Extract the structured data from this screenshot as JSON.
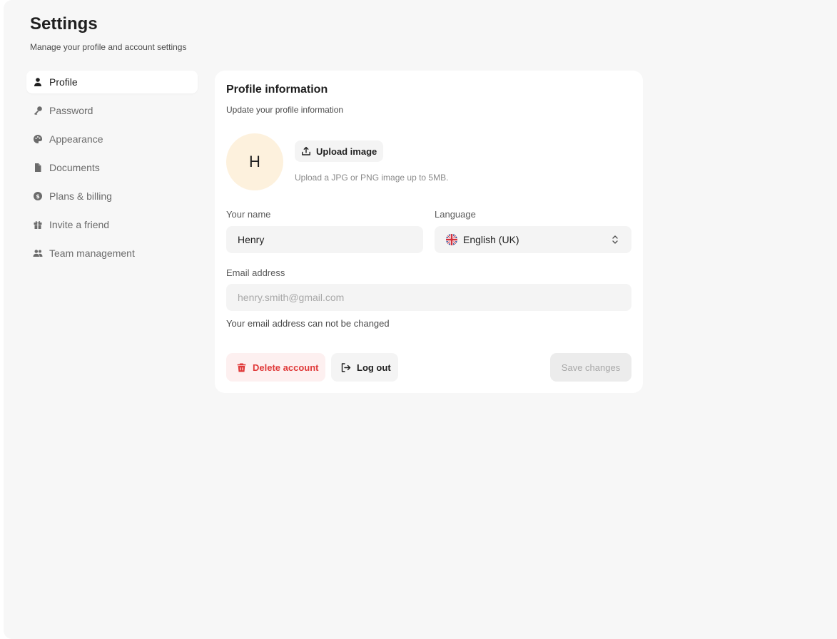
{
  "header": {
    "title": "Settings",
    "subtitle": "Manage your profile and account settings"
  },
  "sidebar": {
    "items": [
      {
        "label": "Profile",
        "icon": "user-icon",
        "active": true
      },
      {
        "label": "Password",
        "icon": "key-icon",
        "active": false
      },
      {
        "label": "Appearance",
        "icon": "palette-icon",
        "active": false
      },
      {
        "label": "Documents",
        "icon": "document-icon",
        "active": false
      },
      {
        "label": "Plans & billing",
        "icon": "dollar-icon",
        "active": false
      },
      {
        "label": "Invite a friend",
        "icon": "gift-icon",
        "active": false
      },
      {
        "label": "Team management",
        "icon": "team-icon",
        "active": false
      }
    ]
  },
  "profile": {
    "title": "Profile information",
    "subtitle": "Update your profile information",
    "avatar_initial": "H",
    "upload_label": "Upload image",
    "upload_hint": "Upload a JPG or PNG image up to 5MB.",
    "name_label": "Your name",
    "name_value": "Henry",
    "language_label": "Language",
    "language_value": "English (UK)",
    "email_label": "Email address",
    "email_placeholder": "henry.smith@gmail.com",
    "email_hint": "Your email address can not be changed"
  },
  "actions": {
    "delete_label": "Delete account",
    "logout_label": "Log out",
    "save_label": "Save changes"
  },
  "colors": {
    "background": "#f7f7f7",
    "card": "#ffffff",
    "avatar_bg": "#fdf1dd",
    "danger": "#e03a3a",
    "danger_bg": "#fdf0f0"
  }
}
